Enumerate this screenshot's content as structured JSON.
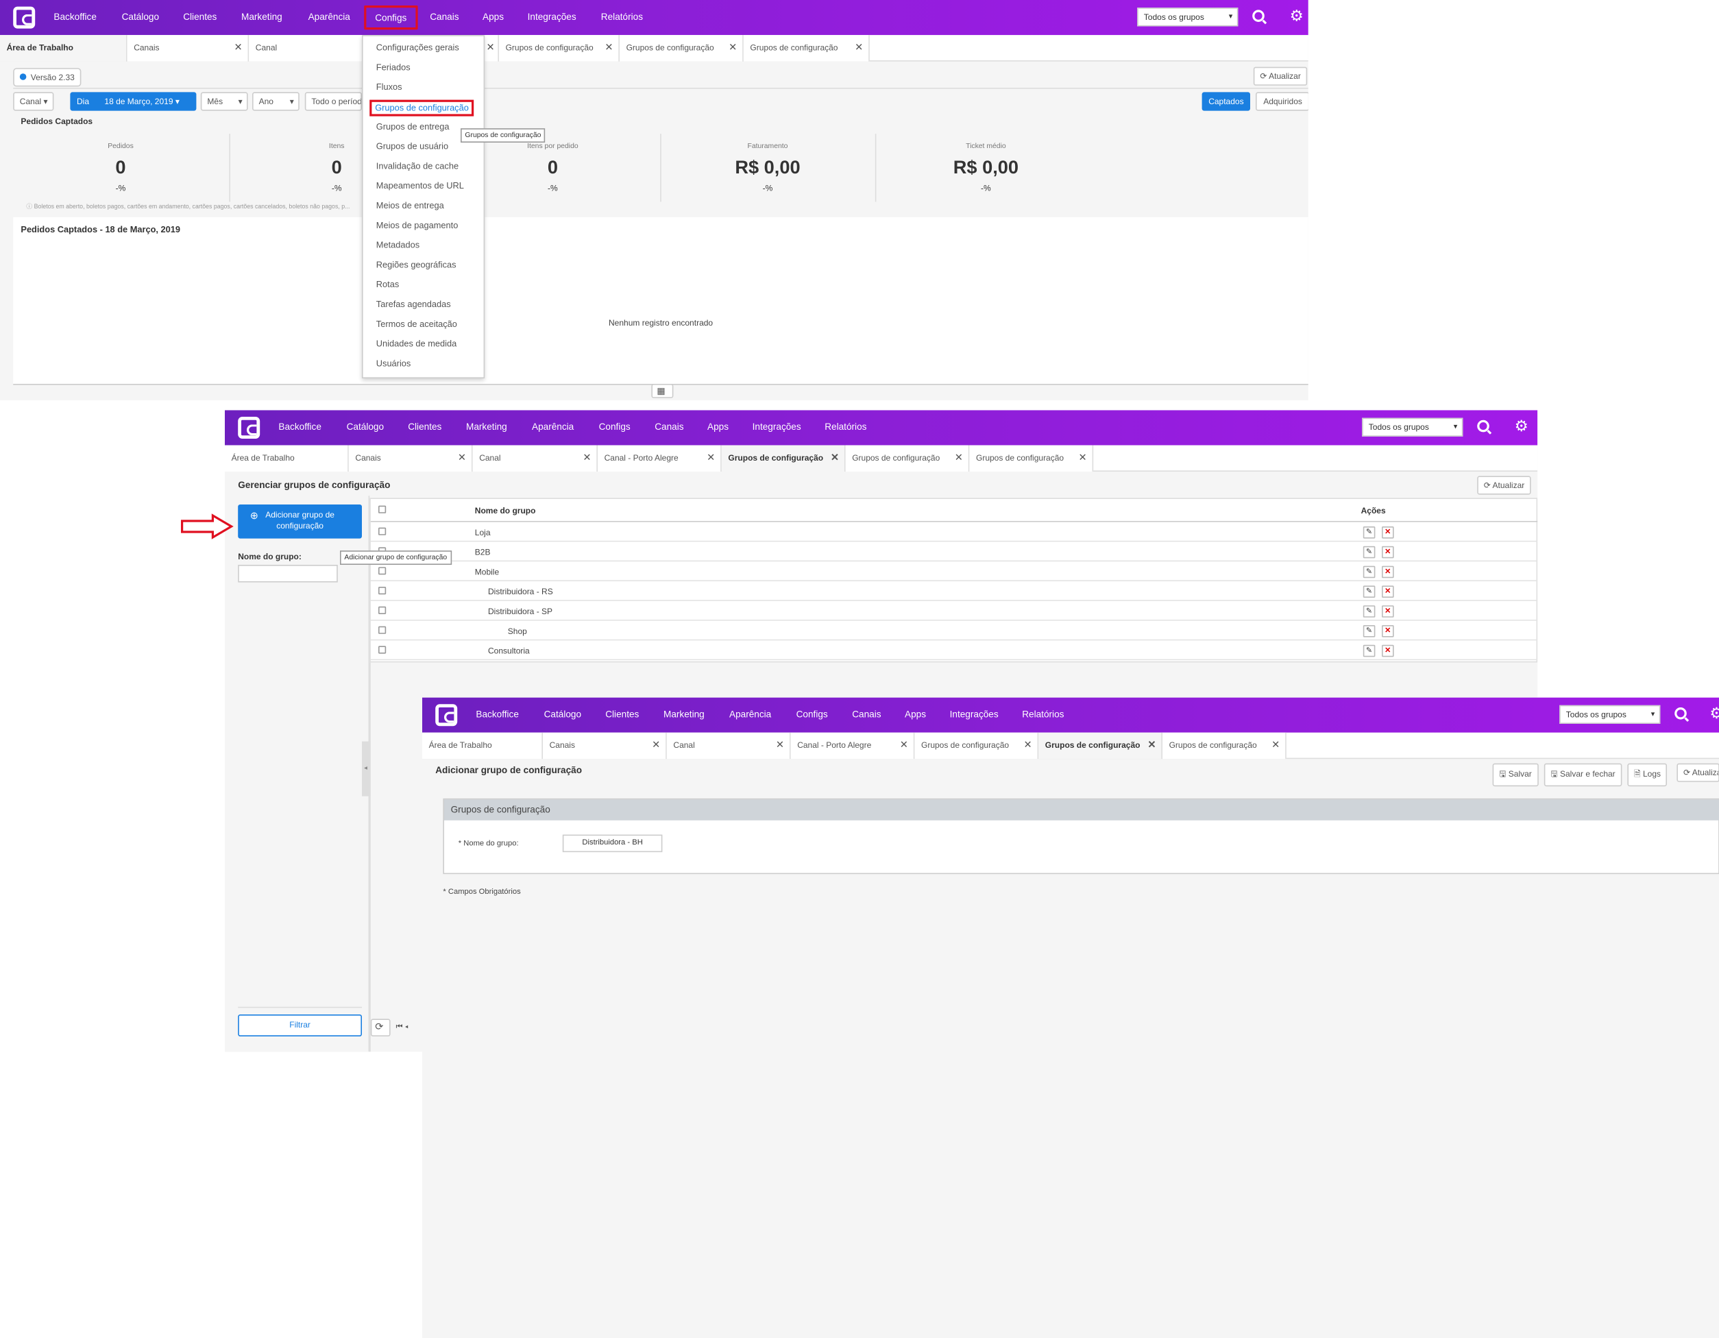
{
  "nav": {
    "items": [
      "Backoffice",
      "Catálogo",
      "Clientes",
      "Marketing",
      "Aparência",
      "Configs",
      "Canais",
      "Apps",
      "Integrações",
      "Relatórios"
    ],
    "group_select": "Todos os grupos"
  },
  "panel1": {
    "tabs": [
      "Área de Trabalho",
      "Canais",
      "Canal",
      "",
      "Grupos de configuração",
      "Grupos de configuração",
      "Grupos de configuração"
    ],
    "version": "Versão 2.33",
    "refresh_label": "Atualizar",
    "filters": {
      "canal": "Canal",
      "dia": "Dia",
      "date": "18 de Março, 2019",
      "mes": "Mês",
      "ano": "Ano",
      "periodo": "Todo o período"
    },
    "toggle": [
      "Captados",
      "Adquiridos"
    ],
    "section_title": "Pedidos Captados",
    "kpis": [
      {
        "label": "Pedidos",
        "value": "0",
        "pct": "-%"
      },
      {
        "label": "Itens",
        "value": "0",
        "pct": "-%"
      },
      {
        "label": "Itens por pedido",
        "value": "0",
        "pct": "-%"
      },
      {
        "label": "Faturamento",
        "value": "R$ 0,00",
        "pct": "-%"
      },
      {
        "label": "Ticket médio",
        "value": "R$ 0,00",
        "pct": "-%"
      }
    ],
    "footnote": "Boletos em aberto, boletos pagos, cartões em andamento, cartões pagos, cartões cancelados, boletos não pagos, p...",
    "chart_title": "Pedidos Captados - 18 de Março, 2019",
    "empty": "Nenhum registro encontrado",
    "menu": [
      "Configurações gerais",
      "Feriados",
      "Fluxos",
      "Grupos de configuração",
      "Grupos de entrega",
      "Grupos de usuário",
      "Invalidação de cache",
      "Mapeamentos de URL",
      "Meios de entrega",
      "Meios de pagamento",
      "Metadados",
      "Regiões geográficas",
      "Rotas",
      "Tarefas agendadas",
      "Termos de aceitação",
      "Unidades de medida",
      "Usuários"
    ],
    "tooltip": "Grupos de configuração"
  },
  "panel2": {
    "tabs": [
      "Área de Trabalho",
      "Canais",
      "Canal",
      "Canal -      Porto Alegre",
      "Grupos de configuração",
      "Grupos de configuração",
      "Grupos de configuração"
    ],
    "title": "Gerenciar grupos de configuração",
    "refresh_label": "Atualizar",
    "add_button": "Adicionar grupo de configuração",
    "tooltip": "Adicionar grupo de configuração",
    "filter_label": "Nome do grupo:",
    "filter_button": "Filtrar",
    "col_name": "Nome do grupo",
    "col_actions": "Ações",
    "rows": [
      {
        "name": "Loja",
        "indent": 0
      },
      {
        "name": "B2B",
        "indent": 0
      },
      {
        "name": "Mobile",
        "indent": 0
      },
      {
        "name": "Distribuidora - RS",
        "indent": 1
      },
      {
        "name": "Distribuidora - SP",
        "indent": 1
      },
      {
        "name": "Shop",
        "indent": 2
      },
      {
        "name": "Consultoria",
        "indent": 1
      }
    ]
  },
  "panel3": {
    "tabs": [
      "Área de Trabalho",
      "Canais",
      "Canal",
      "Canal -      Porto Alegre",
      "Grupos de configuração",
      "Grupos de configuração",
      "Grupos de configuração"
    ],
    "title": "Adicionar grupo de configuração",
    "buttons": [
      "Salvar",
      "Salvar e fechar",
      "Logs",
      "Atualizar"
    ],
    "section": "Grupos de configuração",
    "field_label": "* Nome do grupo:",
    "field_value": "Distribuidora - BH",
    "required_note": "* Campos Obrigatórios"
  },
  "colors": {
    "accent": "#1a7fe0",
    "nav_start": "#6d1fbf",
    "nav_end": "#a21be8",
    "highlight": "#e01020"
  }
}
